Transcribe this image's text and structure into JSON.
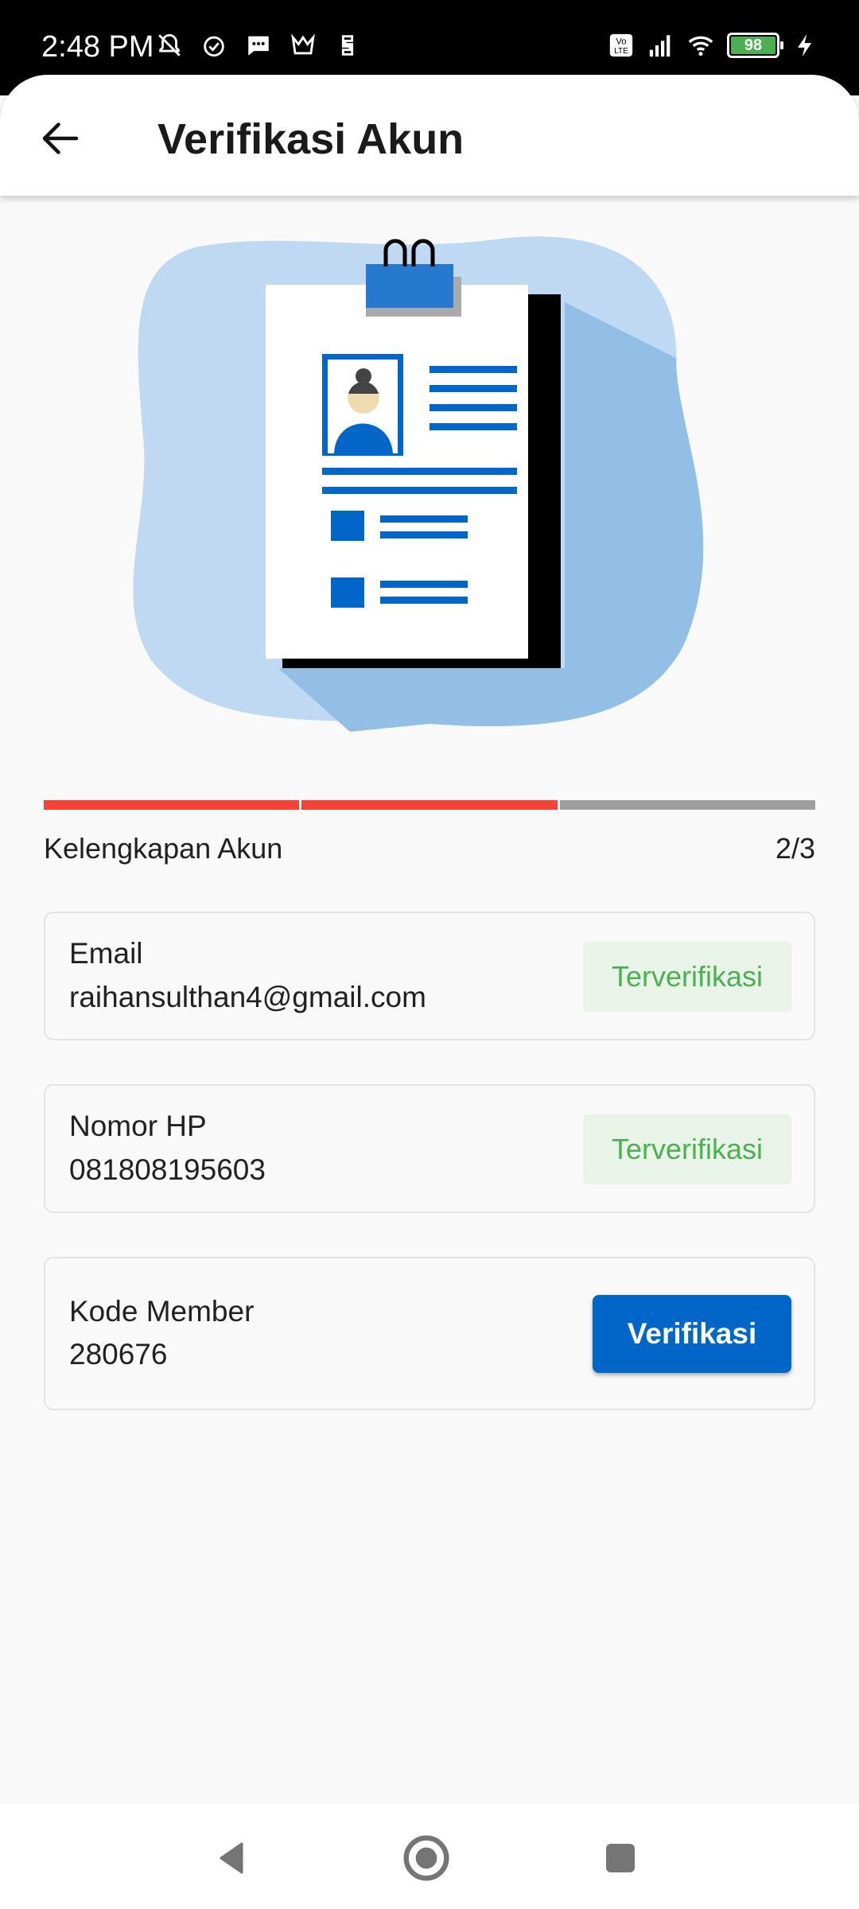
{
  "status_bar": {
    "time": "2:48 PM",
    "battery_level": "98",
    "icons": [
      "mute-icon",
      "alarm-icon",
      "message-icon",
      "app-icon",
      "app-icon-2",
      "volte-icon",
      "signal-icon",
      "wifi-icon",
      "battery-icon",
      "charging-icon"
    ]
  },
  "app_bar": {
    "title": "Verifikasi Akun",
    "back_icon": "arrow-left-icon"
  },
  "progress": {
    "label": "Kelengkapan Akun",
    "count_text": "2/3",
    "completed": 2,
    "total": 3,
    "active_color": "#f44336",
    "inactive_color": "#9e9e9e"
  },
  "cards": [
    {
      "label": "Email",
      "value": "raihansulthan4@gmail.com",
      "status": "Terverifikasi"
    },
    {
      "label": "Nomor HP",
      "value": "081808195603",
      "status": "Terverifikasi"
    },
    {
      "label": "Kode Member",
      "value": "280676",
      "action": "Verifikasi"
    }
  ],
  "colors": {
    "primary": "#0067c8",
    "verified_text": "#4caf50",
    "verified_bg": "#e8f4e8"
  },
  "nav_bar": {
    "icons": [
      "back-nav-icon",
      "home-nav-icon",
      "recents-nav-icon"
    ]
  }
}
